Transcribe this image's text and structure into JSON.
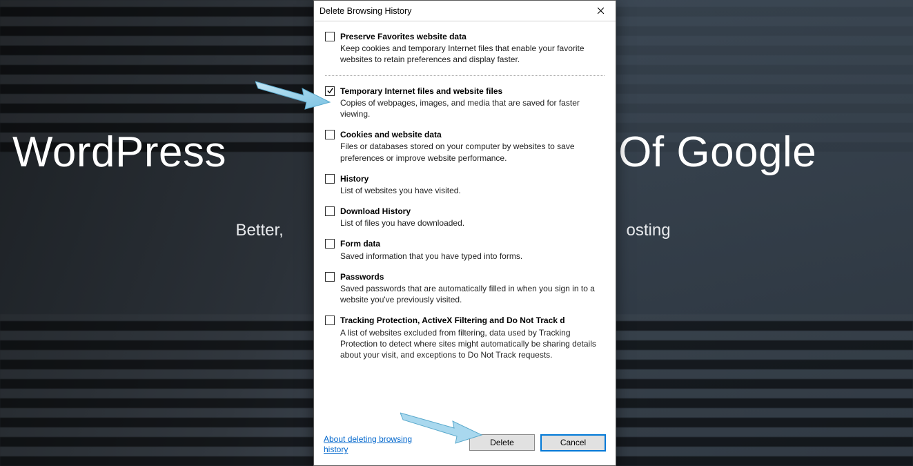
{
  "background": {
    "title_line": "WordPress And Of Google",
    "title_left": "WordPress",
    "title_right": "d Of Google",
    "subtitle_left": "Better,",
    "subtitle_right": "osting"
  },
  "dialog": {
    "title": "Delete Browsing History",
    "close_icon": "close-icon",
    "options": [
      {
        "checked": false,
        "label": "Preserve Favorites website data",
        "desc": "Keep cookies and temporary Internet files that enable your favorite websites to retain preferences and display faster."
      },
      {
        "checked": true,
        "label": "Temporary Internet files and website files",
        "desc": "Copies of webpages, images, and media that are saved for faster viewing."
      },
      {
        "checked": false,
        "label": "Cookies and website data",
        "desc": "Files or databases stored on your computer by websites to save preferences or improve website performance."
      },
      {
        "checked": false,
        "label": "History",
        "desc": "List of websites you have visited."
      },
      {
        "checked": false,
        "label": "Download History",
        "desc": "List of files you have downloaded."
      },
      {
        "checked": false,
        "label": "Form data",
        "desc": "Saved information that you have typed into forms."
      },
      {
        "checked": false,
        "label": "Passwords",
        "desc": "Saved passwords that are automatically filled in when you sign in to a website you've previously visited."
      },
      {
        "checked": false,
        "label": "Tracking Protection, ActiveX Filtering and Do Not Track d",
        "desc": "A list of websites excluded from filtering, data used by Tracking Protection to detect where sites might automatically be sharing details about your visit, and exceptions to Do Not Track requests."
      }
    ],
    "about_link": "About deleting browsing history",
    "delete_label": "Delete",
    "cancel_label": "Cancel"
  },
  "annotations": {
    "arrow_color": "#9fd4ed"
  }
}
